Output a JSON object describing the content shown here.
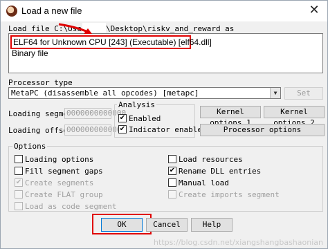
{
  "window": {
    "title": "Load a new file"
  },
  "load_file": {
    "label": "Load file C:\\Users",
    "path_tail": "\\Desktop\\riskv_and_reward as"
  },
  "file_types": [
    "ELF64 for Unknown CPU [243] (Executable) [elf64.dll]",
    "Binary file"
  ],
  "processor": {
    "label": "Processor type",
    "value": "MetaPC (disassemble all opcodes) [metapc]",
    "set_label": "Set"
  },
  "loading_segment": {
    "label": "Loading segment",
    "value": "0000000000000"
  },
  "loading_offset": {
    "label": "Loading offset",
    "value": "0000000000000"
  },
  "analysis": {
    "title": "Analysis",
    "enabled": {
      "label": "Enabled",
      "checked": true
    },
    "indicator": {
      "label": "Indicator enabled",
      "checked": true
    }
  },
  "kernel_options_1": "Kernel options 1",
  "kernel_options_2": "Kernel options 2",
  "processor_options": "Processor options",
  "options": {
    "title": "Options",
    "left": [
      {
        "label": "Loading options",
        "checked": false,
        "enabled": true
      },
      {
        "label": "Fill segment gaps",
        "checked": false,
        "enabled": true
      },
      {
        "label": "Create segments",
        "checked": true,
        "enabled": false
      },
      {
        "label": "Create FLAT group",
        "checked": false,
        "enabled": false
      },
      {
        "label": "Load as code segment",
        "checked": false,
        "enabled": false
      }
    ],
    "right": [
      {
        "label": "Load resources",
        "checked": false,
        "enabled": true
      },
      {
        "label": "Rename DLL entries",
        "checked": true,
        "enabled": true
      },
      {
        "label": "Manual load",
        "checked": false,
        "enabled": true
      },
      {
        "label": "Create imports segment",
        "checked": false,
        "enabled": false
      }
    ]
  },
  "buttons": {
    "ok": "OK",
    "cancel": "Cancel",
    "help": "Help"
  },
  "watermark": "https://blog.csdn.net/xiangshangbashaonian"
}
